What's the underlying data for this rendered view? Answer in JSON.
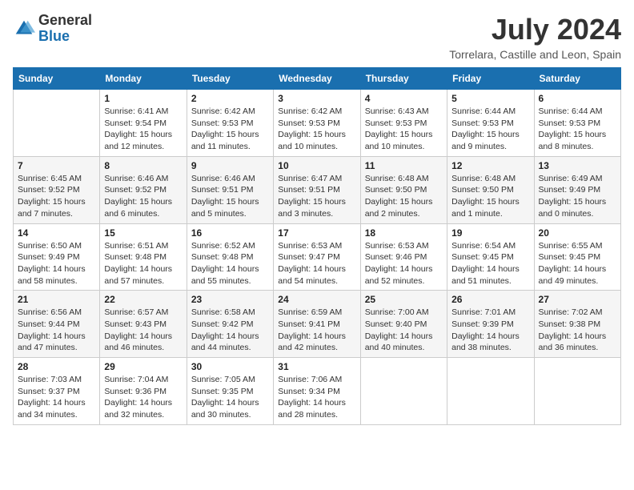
{
  "logo": {
    "general": "General",
    "blue": "Blue"
  },
  "title": {
    "month_year": "July 2024",
    "location": "Torrelara, Castille and Leon, Spain"
  },
  "weekdays": [
    "Sunday",
    "Monday",
    "Tuesday",
    "Wednesday",
    "Thursday",
    "Friday",
    "Saturday"
  ],
  "weeks": [
    [
      {
        "day": "",
        "info": ""
      },
      {
        "day": "1",
        "info": "Sunrise: 6:41 AM\nSunset: 9:54 PM\nDaylight: 15 hours and 12 minutes."
      },
      {
        "day": "2",
        "info": "Sunrise: 6:42 AM\nSunset: 9:53 PM\nDaylight: 15 hours and 11 minutes."
      },
      {
        "day": "3",
        "info": "Sunrise: 6:42 AM\nSunset: 9:53 PM\nDaylight: 15 hours and 10 minutes."
      },
      {
        "day": "4",
        "info": "Sunrise: 6:43 AM\nSunset: 9:53 PM\nDaylight: 15 hours and 10 minutes."
      },
      {
        "day": "5",
        "info": "Sunrise: 6:44 AM\nSunset: 9:53 PM\nDaylight: 15 hours and 9 minutes."
      },
      {
        "day": "6",
        "info": "Sunrise: 6:44 AM\nSunset: 9:53 PM\nDaylight: 15 hours and 8 minutes."
      }
    ],
    [
      {
        "day": "7",
        "info": "Sunrise: 6:45 AM\nSunset: 9:52 PM\nDaylight: 15 hours and 7 minutes."
      },
      {
        "day": "8",
        "info": "Sunrise: 6:46 AM\nSunset: 9:52 PM\nDaylight: 15 hours and 6 minutes."
      },
      {
        "day": "9",
        "info": "Sunrise: 6:46 AM\nSunset: 9:51 PM\nDaylight: 15 hours and 5 minutes."
      },
      {
        "day": "10",
        "info": "Sunrise: 6:47 AM\nSunset: 9:51 PM\nDaylight: 15 hours and 3 minutes."
      },
      {
        "day": "11",
        "info": "Sunrise: 6:48 AM\nSunset: 9:50 PM\nDaylight: 15 hours and 2 minutes."
      },
      {
        "day": "12",
        "info": "Sunrise: 6:48 AM\nSunset: 9:50 PM\nDaylight: 15 hours and 1 minute."
      },
      {
        "day": "13",
        "info": "Sunrise: 6:49 AM\nSunset: 9:49 PM\nDaylight: 15 hours and 0 minutes."
      }
    ],
    [
      {
        "day": "14",
        "info": "Sunrise: 6:50 AM\nSunset: 9:49 PM\nDaylight: 14 hours and 58 minutes."
      },
      {
        "day": "15",
        "info": "Sunrise: 6:51 AM\nSunset: 9:48 PM\nDaylight: 14 hours and 57 minutes."
      },
      {
        "day": "16",
        "info": "Sunrise: 6:52 AM\nSunset: 9:48 PM\nDaylight: 14 hours and 55 minutes."
      },
      {
        "day": "17",
        "info": "Sunrise: 6:53 AM\nSunset: 9:47 PM\nDaylight: 14 hours and 54 minutes."
      },
      {
        "day": "18",
        "info": "Sunrise: 6:53 AM\nSunset: 9:46 PM\nDaylight: 14 hours and 52 minutes."
      },
      {
        "day": "19",
        "info": "Sunrise: 6:54 AM\nSunset: 9:45 PM\nDaylight: 14 hours and 51 minutes."
      },
      {
        "day": "20",
        "info": "Sunrise: 6:55 AM\nSunset: 9:45 PM\nDaylight: 14 hours and 49 minutes."
      }
    ],
    [
      {
        "day": "21",
        "info": "Sunrise: 6:56 AM\nSunset: 9:44 PM\nDaylight: 14 hours and 47 minutes."
      },
      {
        "day": "22",
        "info": "Sunrise: 6:57 AM\nSunset: 9:43 PM\nDaylight: 14 hours and 46 minutes."
      },
      {
        "day": "23",
        "info": "Sunrise: 6:58 AM\nSunset: 9:42 PM\nDaylight: 14 hours and 44 minutes."
      },
      {
        "day": "24",
        "info": "Sunrise: 6:59 AM\nSunset: 9:41 PM\nDaylight: 14 hours and 42 minutes."
      },
      {
        "day": "25",
        "info": "Sunrise: 7:00 AM\nSunset: 9:40 PM\nDaylight: 14 hours and 40 minutes."
      },
      {
        "day": "26",
        "info": "Sunrise: 7:01 AM\nSunset: 9:39 PM\nDaylight: 14 hours and 38 minutes."
      },
      {
        "day": "27",
        "info": "Sunrise: 7:02 AM\nSunset: 9:38 PM\nDaylight: 14 hours and 36 minutes."
      }
    ],
    [
      {
        "day": "28",
        "info": "Sunrise: 7:03 AM\nSunset: 9:37 PM\nDaylight: 14 hours and 34 minutes."
      },
      {
        "day": "29",
        "info": "Sunrise: 7:04 AM\nSunset: 9:36 PM\nDaylight: 14 hours and 32 minutes."
      },
      {
        "day": "30",
        "info": "Sunrise: 7:05 AM\nSunset: 9:35 PM\nDaylight: 14 hours and 30 minutes."
      },
      {
        "day": "31",
        "info": "Sunrise: 7:06 AM\nSunset: 9:34 PM\nDaylight: 14 hours and 28 minutes."
      },
      {
        "day": "",
        "info": ""
      },
      {
        "day": "",
        "info": ""
      },
      {
        "day": "",
        "info": ""
      }
    ]
  ]
}
